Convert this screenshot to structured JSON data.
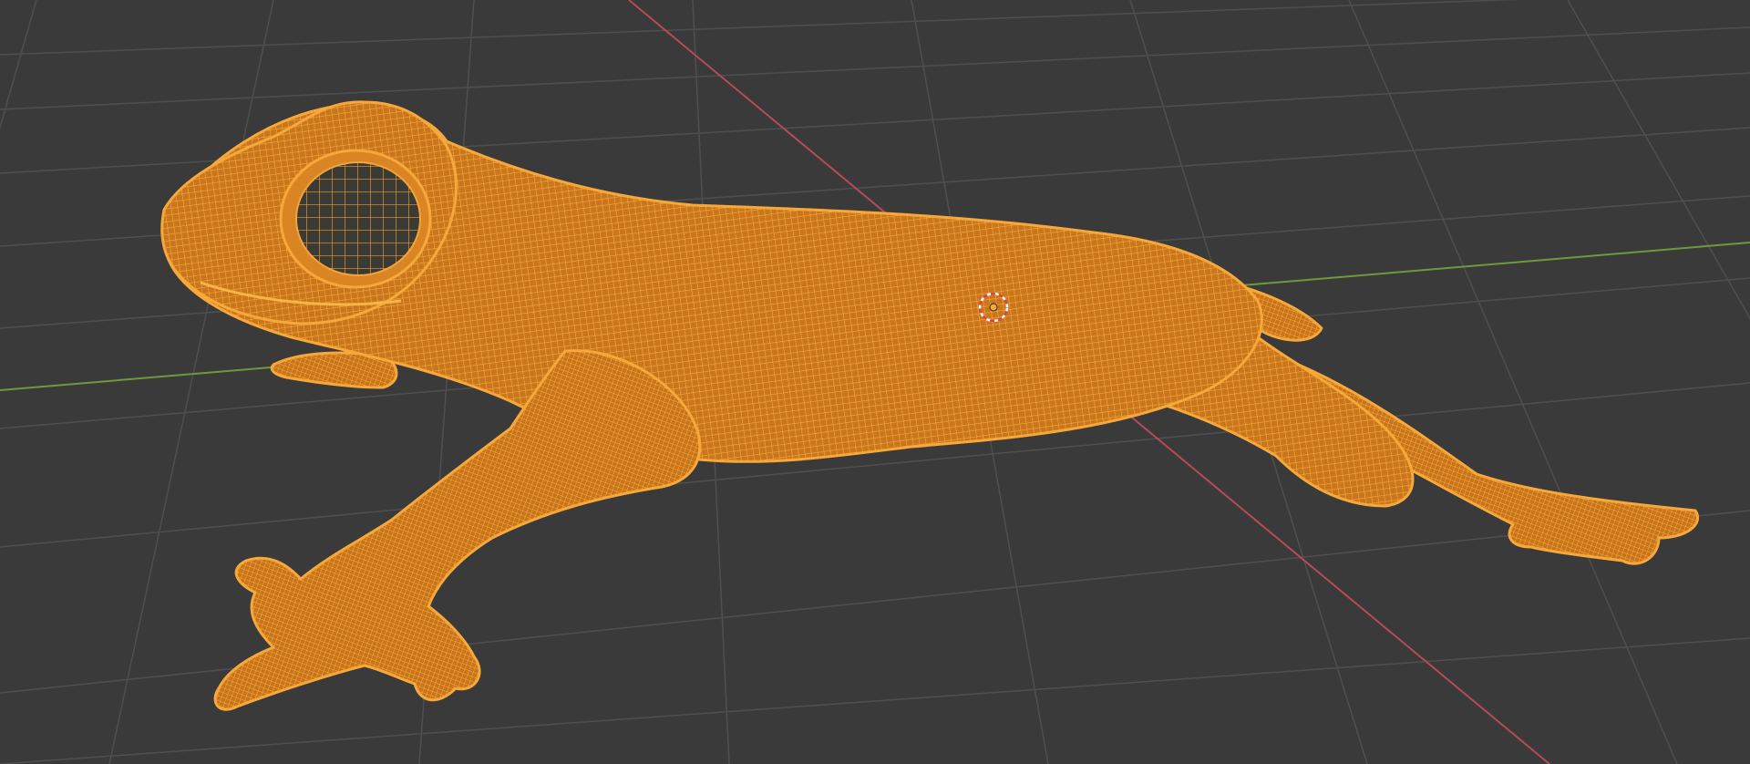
{
  "viewport": {
    "mode": "wireframe",
    "background": "#3a3a3a",
    "grid_color": "#4f4f4f",
    "axis_x_color": "#b54a5b",
    "axis_y_color": "#6c9a3c",
    "selection_color": "#f2a136"
  },
  "scene": {
    "selected_object": "frog-mesh",
    "cursor_icon": "3d-cursor-icon",
    "origin_icon": "object-origin-icon"
  }
}
